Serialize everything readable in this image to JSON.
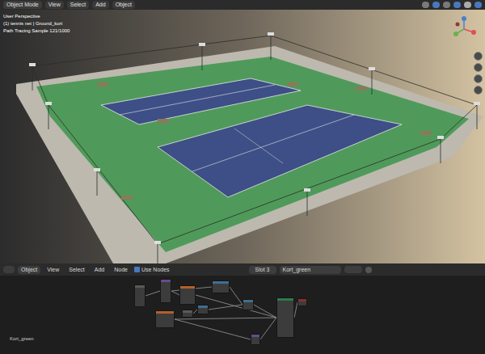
{
  "top_bar": {
    "mode": "Object Mode",
    "menu": [
      "View",
      "Select",
      "Add",
      "Object"
    ]
  },
  "viewport": {
    "overlay": [
      "User Perspective",
      "(1) tennis net | Ground_kort",
      "Path Tracing Sample 121/1000"
    ]
  },
  "node_editor": {
    "header": {
      "data_type": "Object",
      "menu": [
        "View",
        "Select",
        "Add",
        "Node"
      ],
      "use_nodes": {
        "label": "Use Nodes",
        "checked": true
      },
      "slot": "Slot 3",
      "material": "Kort_green"
    },
    "nodes": [
      {
        "color": "#5a5a5a"
      },
      {
        "color": "#6a4a8a"
      },
      {
        "color": "#b3602c"
      },
      {
        "color": "#3f6f8f"
      },
      {
        "color": "#3f6f8f"
      },
      {
        "color": "#5a5a5a"
      },
      {
        "color": "#b3602c"
      },
      {
        "color": "#3f6f8f"
      },
      {
        "color": "#2f7a4c"
      },
      {
        "color": "#8c2e2e"
      },
      {
        "color": "#6a4a8a"
      }
    ],
    "footer_label": "Kort_green"
  }
}
